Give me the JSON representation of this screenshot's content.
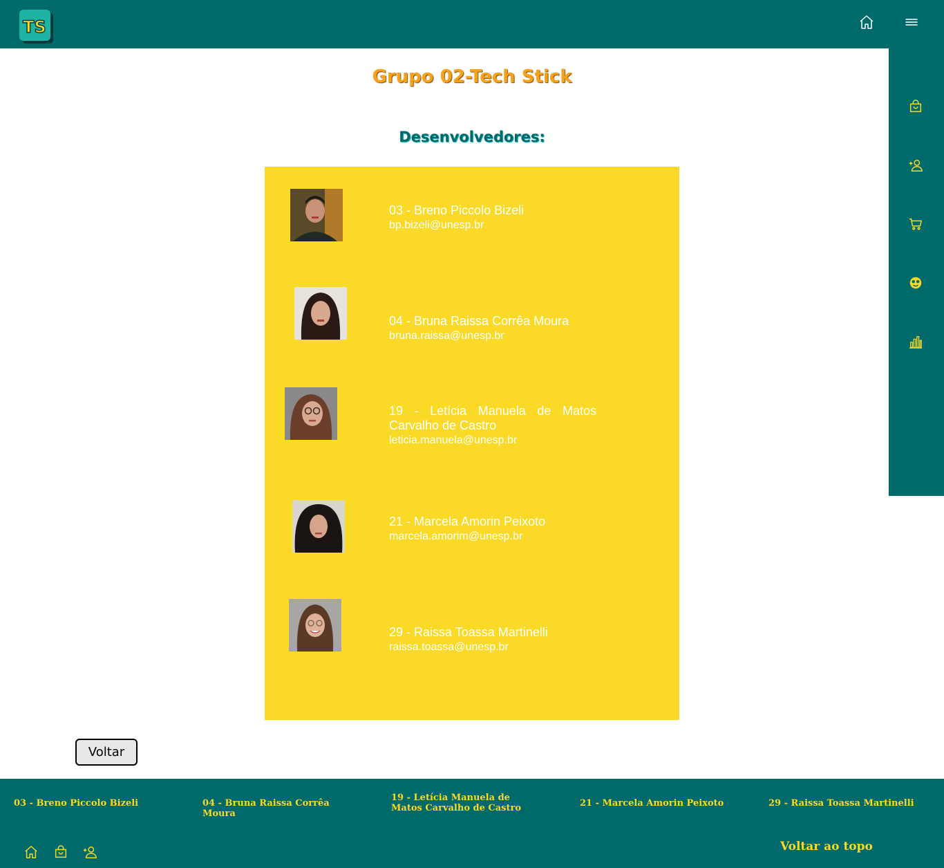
{
  "header": {
    "logo_text": "TS"
  },
  "page": {
    "title": "Grupo 02-Tech Stick",
    "section_title": "Desenvolvedores:"
  },
  "developers": [
    {
      "name": "03 - Breno Piccolo Bizeli",
      "email": "bp.bizeli@unesp.br"
    },
    {
      "name": "04 - Bruna Raissa Corrêa Moura",
      "email": "bruna.raissa@unesp.br"
    },
    {
      "name": "19 - Letícia Manuela de Matos Carvalho de Castro",
      "email": "leticia.manuela@unesp.br"
    },
    {
      "name": "21 - Marcela Amorin Peixoto",
      "email": "marcela.amorim@unesp.br"
    },
    {
      "name": "29 - Raissa Toassa Martinelli",
      "email": "raissa.toassa@unesp.br"
    }
  ],
  "back_button": "Voltar",
  "footer": {
    "names": [
      "03 - Breno Piccolo Bizeli",
      "04 - Bruna Raissa Corrêa Moura",
      "19 - Letícia Manuela de Matos Carvalho de Castro",
      "21 - Marcela Amorin Peixoto",
      "29 - Raissa Toassa Martinelli"
    ],
    "back_to_top": "Voltar ao topo"
  },
  "icons": {
    "top": [
      "home-icon",
      "menu-icon"
    ],
    "sidebar": [
      "shopping-bag-icon",
      "add-user-icon",
      "cart-icon",
      "emoji-icon",
      "bar-chart-icon"
    ],
    "footer": [
      "home-icon",
      "shopping-bag-icon",
      "add-user-icon"
    ]
  },
  "colors": {
    "teal": "#006a6b",
    "yellow": "#fbd927",
    "orange": "#f7a21b"
  }
}
